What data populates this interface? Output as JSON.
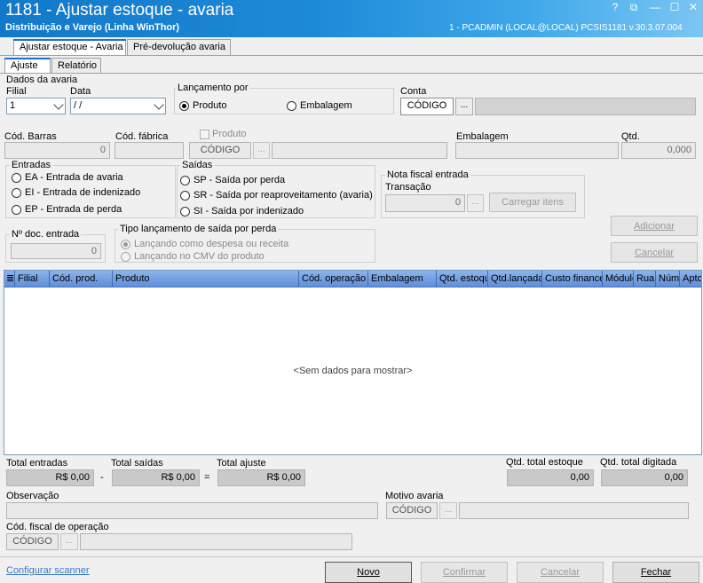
{
  "window": {
    "title": "1181 - Ajustar estoque - avaria",
    "subtitle": "Distribuição e Varejo (Linha WinThor)",
    "userinfo": "1 - PCADMIN (LOCAL@LOCAL)   PCSIS1181  v.30.3.07.004",
    "help": "?",
    "restore": "⧉",
    "minimize": "—",
    "maximize": "☐",
    "close": "✕"
  },
  "tabs": {
    "main": [
      "Ajustar estoque - Avaria",
      "Pré-devolução avaria"
    ],
    "sub": [
      "Ajuste",
      "Relatório"
    ]
  },
  "dados": {
    "title": "Dados da avaria",
    "filial_label": "Filial",
    "filial_value": "1",
    "data_label": "Data",
    "data_value": " /  /",
    "lancamento_title": "Lançamento por",
    "produto": "Produto",
    "embalagem": "Embalagem",
    "conta_label": "Conta",
    "codigo": "CÓDIGO",
    "ellipsis": "..."
  },
  "produto_row": {
    "cod_barras": "Cód. Barras",
    "cod_barras_value": "0",
    "cod_fabrica": "Cód. fábrica",
    "produto_chk": "Produto",
    "codigo": "CÓDIGO",
    "embalagem": "Embalagem",
    "qtd": "Qtd.",
    "qtd_value": "0,000"
  },
  "entradas": {
    "title": "Entradas",
    "items": [
      "EA - Entrada de avaria",
      "EI - Entrada de indenizado",
      "EP - Entrada de perda"
    ]
  },
  "saidas": {
    "title": "Saídas",
    "items": [
      "SP - Saída por perda",
      "SR - Saída por reaproveitamento (avaria)",
      "SI - Saída por indenizado"
    ]
  },
  "nota": {
    "title": "Nota fiscal entrada",
    "transacao": "Transação",
    "transacao_value": "0",
    "carregar": "Carregar itens"
  },
  "buttons": {
    "adicionar": "Adicionar",
    "cancelar": "Cancelar"
  },
  "ndoc": {
    "title": "Nº doc. entrada",
    "value": "0"
  },
  "tipo": {
    "title": "Tipo lançamento de saída por perda",
    "items": [
      "Lançando como despesa ou receita",
      "Lançando no CMV do produto"
    ]
  },
  "grid": {
    "columns": [
      "Filial",
      "Cód. prod.",
      "Produto",
      "Cód. operação",
      "Embalagem",
      "Qtd. estoque",
      "Qtd.lançada",
      "Custo financeiro",
      "Módulo",
      "Rua",
      "Núm",
      "Apto"
    ],
    "empty": "<Sem dados para mostrar>"
  },
  "totals": {
    "entradas": "Total entradas",
    "entradas_value": "R$ 0,00",
    "saidas": "Total saídas",
    "saidas_value": "R$ 0,00",
    "ajuste": "Total ajuste",
    "ajuste_value": "R$ 0,00",
    "minus": "-",
    "equals": "=",
    "qtd_estoque": "Qtd. total estoque",
    "qtd_estoque_value": "0,00",
    "qtd_digitada": "Qtd. total digitada",
    "qtd_digitada_value": "0,00"
  },
  "bottom": {
    "observacao": "Observação",
    "motivo": "Motivo avaria",
    "codigo": "CÓDIGO",
    "cod_fiscal": "Cód. fiscal de operação",
    "configurar": "Configurar scanner",
    "novo": "Novo",
    "confirmar": "Confirmar",
    "cancelar": "Cancelar",
    "fechar": "Fechar"
  }
}
